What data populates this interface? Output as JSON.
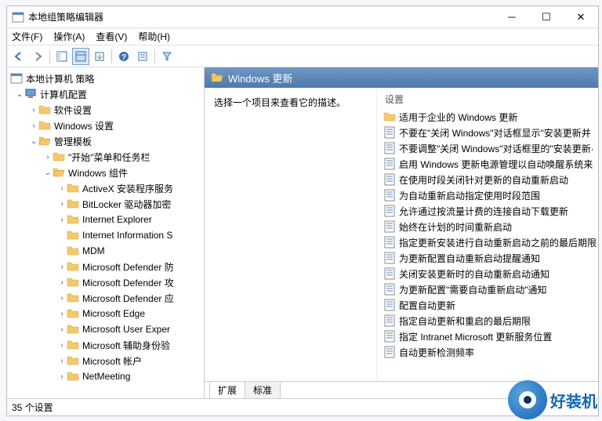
{
  "window": {
    "title": "本地组策略编辑器"
  },
  "menu": {
    "file": "文件(F)",
    "action": "操作(A)",
    "view": "查看(V)",
    "help": "帮助(H)"
  },
  "tree": {
    "root": "本地计算机 策略",
    "computer": "计算机配置",
    "software": "软件设置",
    "winset": "Windows 设置",
    "admintpl": "管理模板",
    "startbar": "\"开始\"菜单和任务栏",
    "wincomp": "Windows 组件",
    "items": [
      "ActiveX 安装程序服务",
      "BitLocker 驱动器加密",
      "Internet Explorer",
      "Internet Information S",
      "MDM",
      "Microsoft Defender 防",
      "Microsoft Defender 攻",
      "Microsoft Defender 应",
      "Microsoft Edge",
      "Microsoft User Exper",
      "Microsoft 辅助身份验",
      "Microsoft 帐户",
      "NetMeeting"
    ]
  },
  "header": {
    "title": "Windows 更新"
  },
  "desc": "选择一个项目来查看它的描述。",
  "settings_label": "设置",
  "settings": [
    {
      "type": "folder",
      "label": "适用于企业的 Windows 更新"
    },
    {
      "type": "policy",
      "label": "不要在\"关闭 Windows\"对话框显示\"安装更新并"
    },
    {
      "type": "policy",
      "label": "不要调整\"关闭 Windows\"对话框里的\"安装更新·"
    },
    {
      "type": "policy",
      "label": "启用 Windows 更新电源管理以自动唤醒系统来"
    },
    {
      "type": "policy",
      "label": "在使用时段关闭针对更新的自动重新启动"
    },
    {
      "type": "policy",
      "label": "为自动重新启动指定使用时段范围"
    },
    {
      "type": "policy",
      "label": "允许通过按流量计费的连接自动下载更新"
    },
    {
      "type": "policy",
      "label": "始终在计划的时间重新启动"
    },
    {
      "type": "policy",
      "label": "指定更新安装进行自动重新启动之前的最后期限"
    },
    {
      "type": "policy",
      "label": "为更新配置自动重新启动提醒通知"
    },
    {
      "type": "policy",
      "label": "关闭安装更新时的自动重新启动通知"
    },
    {
      "type": "policy",
      "label": "为更新配置\"需要自动重新启动\"通知"
    },
    {
      "type": "policy",
      "label": "配置自动更新"
    },
    {
      "type": "policy",
      "label": "指定自动更新和重启的最后期限"
    },
    {
      "type": "policy",
      "label": "指定 Intranet Microsoft 更新服务位置"
    },
    {
      "type": "policy",
      "label": "自动更新检测频率"
    }
  ],
  "tabs": {
    "extended": "扩展",
    "standard": "标准"
  },
  "status": "35 个设置",
  "brand": "好装机"
}
